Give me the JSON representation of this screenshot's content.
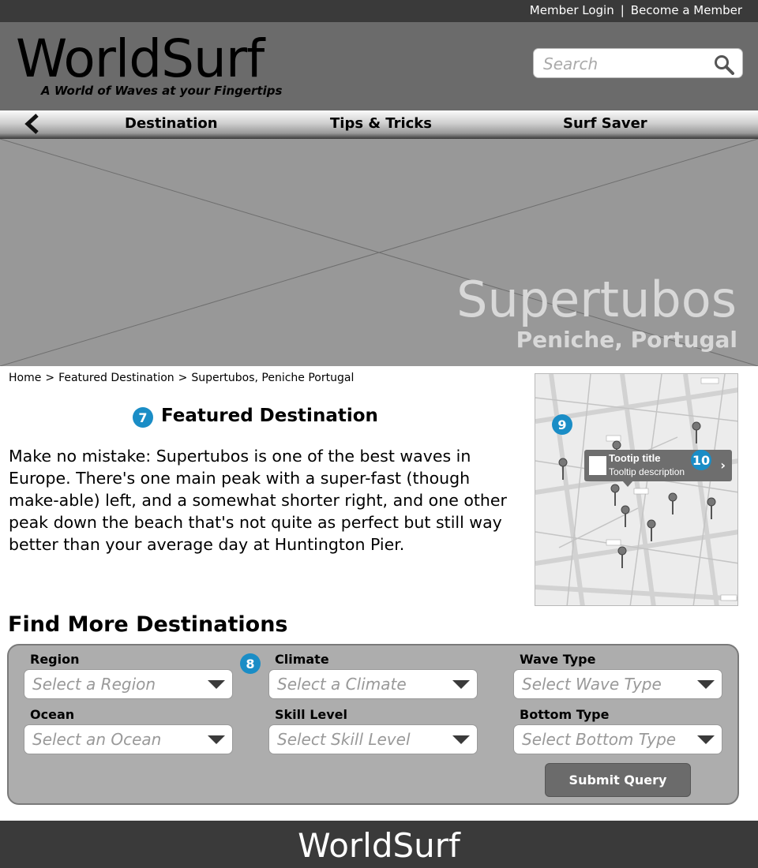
{
  "topbar": {
    "member_login": "Member Login",
    "separator": "|",
    "become_member": "Become a Member"
  },
  "header": {
    "logo": "WorldSurf",
    "tagline": "A World of Waves at your Fingertips",
    "search_placeholder": "Search"
  },
  "nav": {
    "items": [
      "Destination",
      "Tips & Tricks",
      "Surf Saver"
    ]
  },
  "hero": {
    "title": "Supertubos",
    "subtitle": "Peniche, Portugal"
  },
  "breadcrumb": [
    "Home",
    ">",
    "Featured Destination",
    ">",
    "Supertubos, Peniche Portugal"
  ],
  "featured": {
    "badge": "7",
    "heading": "Featured Destination",
    "text": "Make no mistake: Supertubos is one of the best waves in Europe. There's one main peak with a super-fast (though make-able) left, and a somewhat shorter right, and one other peak down the beach that's not quite as perfect but still way better than your average day at Huntington Pier."
  },
  "map": {
    "badge9": "9",
    "badge10": "10",
    "tooltip_title": "Tootip title",
    "tooltip_desc": "Tooltip description",
    "tooltip_chevron": "›"
  },
  "finder": {
    "heading": "Find More Destinations",
    "badge": "8",
    "fields": [
      {
        "label": "Region",
        "placeholder": "Select a Region"
      },
      {
        "label": "Climate",
        "placeholder": "Select a Climate"
      },
      {
        "label": "Wave Type",
        "placeholder": "Select Wave Type"
      },
      {
        "label": "Ocean",
        "placeholder": "Select an Ocean"
      },
      {
        "label": "Skill Level",
        "placeholder": "Select Skill Level"
      },
      {
        "label": "Bottom Type",
        "placeholder": "Select Bottom Type"
      }
    ],
    "submit": "Submit Query"
  },
  "footer": {
    "logo": "WorldSurf"
  },
  "colors": {
    "accent_badge": "#1a8dc6",
    "topbar": "#3a3a3a",
    "header": "#6b6b6b",
    "hero": "#989898",
    "finder": "#adadad"
  },
  "icons": {
    "search": "search-icon",
    "back": "chevron-left-icon",
    "pin": "map-pin-icon",
    "dropdown": "caret-down-icon"
  }
}
